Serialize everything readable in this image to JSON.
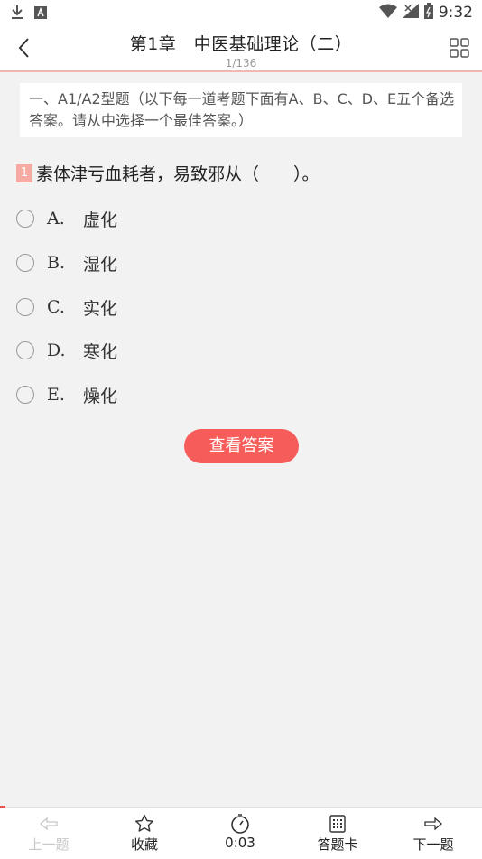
{
  "status_bar": {
    "time": "9:32"
  },
  "header": {
    "title": "第1章　中医基础理论（二）",
    "progress": "1/136"
  },
  "instructions": "一、A1/A2型题（以下每一道考题下面有A、B、C、D、E五个备选答案。请从中选择一个最佳答案。）",
  "question": {
    "number": "1",
    "text": "素体津亏血耗者，易致邪从（　　）。"
  },
  "options": [
    {
      "letter": "A.",
      "text": "虚化"
    },
    {
      "letter": "B.",
      "text": "湿化"
    },
    {
      "letter": "C.",
      "text": "实化"
    },
    {
      "letter": "D.",
      "text": "寒化"
    },
    {
      "letter": "E.",
      "text": "燥化"
    }
  ],
  "answer_button": "查看答案",
  "bottom_nav": {
    "prev": "上一题",
    "favorite": "收藏",
    "timer": "0:03",
    "answer_card": "答题卡",
    "next": "下一题"
  },
  "colors": {
    "accent": "#f65d5a",
    "number_badge": "#f7a9a4"
  }
}
